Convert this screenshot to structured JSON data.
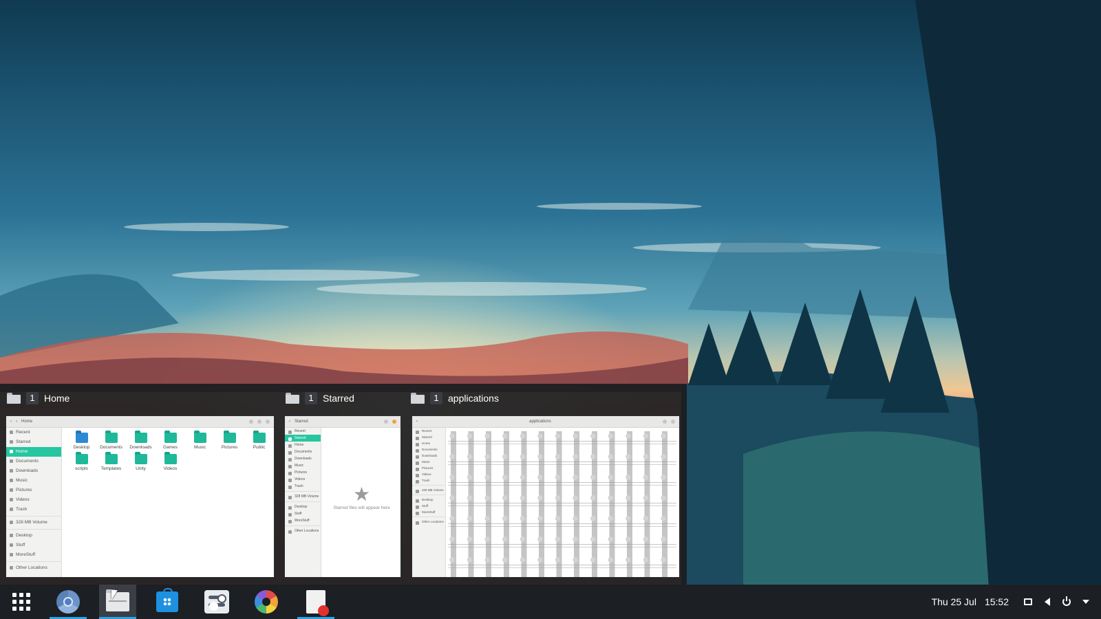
{
  "desktop": {
    "wallpaper": "sunset-forest-landscape"
  },
  "switcher": {
    "groups": [
      {
        "count": "1",
        "title": "Home",
        "thumbnail": {
          "location": "Home",
          "sidebar": [
            "Recent",
            "Starred",
            "Home",
            "Documents",
            "Downloads",
            "Music",
            "Pictures",
            "Videos",
            "Trash",
            "328 MB Volume",
            "Desktop",
            "Stuff",
            "MoreStuff",
            "Other Locations"
          ],
          "active": "Home",
          "items": [
            "Desktop",
            "Documents",
            "Downloads",
            "Games",
            "Music",
            "Pictures",
            "Public",
            "scripts",
            "Templates",
            "Unity",
            "Videos"
          ]
        }
      },
      {
        "count": "1",
        "title": "Starred",
        "thumbnail": {
          "location": "Starred",
          "sidebar": [
            "Recent",
            "Starred",
            "Home",
            "Documents",
            "Downloads",
            "Music",
            "Pictures",
            "Videos",
            "Trash",
            "328 MB Volume",
            "Desktop",
            "Stuff",
            "MoreStuff",
            "Other Locations"
          ],
          "active": "Starred",
          "empty_message": "Starred files will appear here"
        }
      },
      {
        "count": "1",
        "title": "applications",
        "thumbnail": {
          "location": "applications",
          "sidebar": [
            "Recent",
            "Starred",
            "Home",
            "Documents",
            "Downloads",
            "Music",
            "Pictures",
            "Videos",
            "Trash",
            "328 MB Volume",
            "Desktop",
            "Stuff",
            "MoreStuff",
            "Other Locations"
          ]
        }
      }
    ]
  },
  "taskbar": {
    "apps": [
      {
        "name": "app-grid",
        "icon": "grid-icon",
        "running": false
      },
      {
        "name": "chromium",
        "icon": "chromium-icon",
        "running": true
      },
      {
        "name": "files",
        "icon": "files-icon",
        "running": true,
        "focused": true
      },
      {
        "name": "software-store",
        "icon": "store-icon",
        "running": false
      },
      {
        "name": "settings",
        "icon": "settings-icon",
        "running": false
      },
      {
        "name": "photo-app",
        "icon": "aperture-icon",
        "running": false
      },
      {
        "name": "text-editor",
        "icon": "text-editor-icon",
        "running": true
      }
    ],
    "clock": {
      "date": "Thu 25 Jul",
      "time": "15:52"
    }
  },
  "colors": {
    "accent": "#26c6a0",
    "running_indicator": "#2aa3e0",
    "panel": "#1c1f23"
  }
}
